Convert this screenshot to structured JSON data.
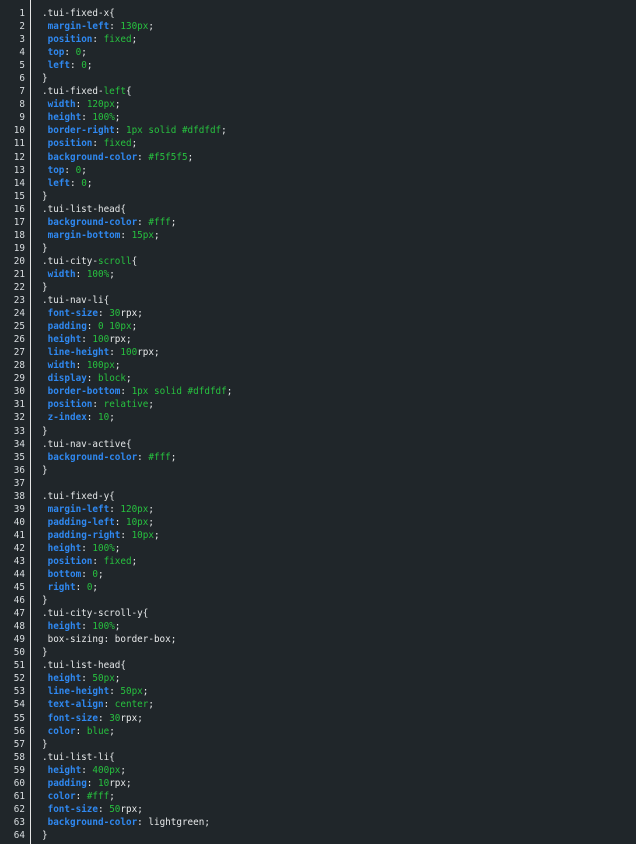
{
  "editor": {
    "lines": [
      [
        {
          "t": "sel",
          "v": ".tui-fixed-x{"
        }
      ],
      [
        {
          "t": "ind",
          "v": " "
        },
        {
          "t": "prop",
          "v": "margin-left"
        },
        {
          "t": "punc",
          "v": ": "
        },
        {
          "t": "val",
          "v": "130px"
        },
        {
          "t": "punc",
          "v": ";"
        }
      ],
      [
        {
          "t": "ind",
          "v": " "
        },
        {
          "t": "prop",
          "v": "position"
        },
        {
          "t": "punc",
          "v": ": "
        },
        {
          "t": "val",
          "v": "fixed"
        },
        {
          "t": "punc",
          "v": ";"
        }
      ],
      [
        {
          "t": "ind",
          "v": " "
        },
        {
          "t": "prop",
          "v": "top"
        },
        {
          "t": "punc",
          "v": ": "
        },
        {
          "t": "val",
          "v": "0"
        },
        {
          "t": "punc",
          "v": ";"
        }
      ],
      [
        {
          "t": "ind",
          "v": " "
        },
        {
          "t": "prop",
          "v": "left"
        },
        {
          "t": "punc",
          "v": ": "
        },
        {
          "t": "val",
          "v": "0"
        },
        {
          "t": "punc",
          "v": ";"
        }
      ],
      [
        {
          "t": "sel",
          "v": "}"
        }
      ],
      [
        {
          "t": "sel",
          "v": ".tui-fixed-"
        },
        {
          "t": "val",
          "v": "left"
        },
        {
          "t": "sel",
          "v": "{"
        }
      ],
      [
        {
          "t": "ind",
          "v": " "
        },
        {
          "t": "prop",
          "v": "width"
        },
        {
          "t": "punc",
          "v": ": "
        },
        {
          "t": "val",
          "v": "120px"
        },
        {
          "t": "punc",
          "v": ";"
        }
      ],
      [
        {
          "t": "ind",
          "v": " "
        },
        {
          "t": "prop",
          "v": "height"
        },
        {
          "t": "punc",
          "v": ": "
        },
        {
          "t": "val",
          "v": "100%"
        },
        {
          "t": "punc",
          "v": ";"
        }
      ],
      [
        {
          "t": "ind",
          "v": " "
        },
        {
          "t": "prop",
          "v": "border-right"
        },
        {
          "t": "punc",
          "v": ": "
        },
        {
          "t": "val",
          "v": "1px solid #dfdfdf"
        },
        {
          "t": "punc",
          "v": ";"
        }
      ],
      [
        {
          "t": "ind",
          "v": " "
        },
        {
          "t": "prop",
          "v": "position"
        },
        {
          "t": "punc",
          "v": ": "
        },
        {
          "t": "val",
          "v": "fixed"
        },
        {
          "t": "punc",
          "v": ";"
        }
      ],
      [
        {
          "t": "ind",
          "v": " "
        },
        {
          "t": "prop",
          "v": "background-color"
        },
        {
          "t": "punc",
          "v": ": "
        },
        {
          "t": "val",
          "v": "#f5f5f5"
        },
        {
          "t": "punc",
          "v": ";"
        }
      ],
      [
        {
          "t": "ind",
          "v": " "
        },
        {
          "t": "prop",
          "v": "top"
        },
        {
          "t": "punc",
          "v": ": "
        },
        {
          "t": "val",
          "v": "0"
        },
        {
          "t": "punc",
          "v": ";"
        }
      ],
      [
        {
          "t": "ind",
          "v": " "
        },
        {
          "t": "prop",
          "v": "left"
        },
        {
          "t": "punc",
          "v": ": "
        },
        {
          "t": "val",
          "v": "0"
        },
        {
          "t": "punc",
          "v": ";"
        }
      ],
      [
        {
          "t": "sel",
          "v": "}"
        }
      ],
      [
        {
          "t": "sel",
          "v": ".tui-list-head{"
        }
      ],
      [
        {
          "t": "ind",
          "v": " "
        },
        {
          "t": "prop",
          "v": "background-color"
        },
        {
          "t": "punc",
          "v": ": "
        },
        {
          "t": "val",
          "v": "#fff"
        },
        {
          "t": "punc",
          "v": ";"
        }
      ],
      [
        {
          "t": "ind",
          "v": " "
        },
        {
          "t": "prop",
          "v": "margin-bottom"
        },
        {
          "t": "punc",
          "v": ": "
        },
        {
          "t": "val",
          "v": "15px"
        },
        {
          "t": "punc",
          "v": ";"
        }
      ],
      [
        {
          "t": "sel",
          "v": "}"
        }
      ],
      [
        {
          "t": "sel",
          "v": ".tui-city-"
        },
        {
          "t": "val",
          "v": "scroll"
        },
        {
          "t": "sel",
          "v": "{"
        }
      ],
      [
        {
          "t": "ind",
          "v": " "
        },
        {
          "t": "prop",
          "v": "width"
        },
        {
          "t": "punc",
          "v": ": "
        },
        {
          "t": "val",
          "v": "100%"
        },
        {
          "t": "punc",
          "v": ";"
        }
      ],
      [
        {
          "t": "sel",
          "v": "}"
        }
      ],
      [
        {
          "t": "sel",
          "v": ".tui-nav-li{"
        }
      ],
      [
        {
          "t": "ind",
          "v": " "
        },
        {
          "t": "prop",
          "v": "font-size"
        },
        {
          "t": "punc",
          "v": ": "
        },
        {
          "t": "val",
          "v": "30"
        },
        {
          "t": "plain",
          "v": "rpx"
        },
        {
          "t": "punc",
          "v": ";"
        }
      ],
      [
        {
          "t": "ind",
          "v": " "
        },
        {
          "t": "prop",
          "v": "padding"
        },
        {
          "t": "punc",
          "v": ": "
        },
        {
          "t": "val",
          "v": "0 10px"
        },
        {
          "t": "punc",
          "v": ";"
        }
      ],
      [
        {
          "t": "ind",
          "v": " "
        },
        {
          "t": "prop",
          "v": "height"
        },
        {
          "t": "punc",
          "v": ": "
        },
        {
          "t": "val",
          "v": "100"
        },
        {
          "t": "plain",
          "v": "rpx"
        },
        {
          "t": "punc",
          "v": ";"
        }
      ],
      [
        {
          "t": "ind",
          "v": " "
        },
        {
          "t": "prop",
          "v": "line-height"
        },
        {
          "t": "punc",
          "v": ": "
        },
        {
          "t": "val",
          "v": "100"
        },
        {
          "t": "plain",
          "v": "rpx"
        },
        {
          "t": "punc",
          "v": ";"
        }
      ],
      [
        {
          "t": "ind",
          "v": " "
        },
        {
          "t": "prop",
          "v": "width"
        },
        {
          "t": "punc",
          "v": ": "
        },
        {
          "t": "val",
          "v": "100px"
        },
        {
          "t": "punc",
          "v": ";"
        }
      ],
      [
        {
          "t": "ind",
          "v": " "
        },
        {
          "t": "prop",
          "v": "display"
        },
        {
          "t": "punc",
          "v": ": "
        },
        {
          "t": "val",
          "v": "block"
        },
        {
          "t": "punc",
          "v": ";"
        }
      ],
      [
        {
          "t": "ind",
          "v": " "
        },
        {
          "t": "prop",
          "v": "border-bottom"
        },
        {
          "t": "punc",
          "v": ": "
        },
        {
          "t": "val",
          "v": "1px solid #dfdfdf"
        },
        {
          "t": "punc",
          "v": ";"
        }
      ],
      [
        {
          "t": "ind",
          "v": " "
        },
        {
          "t": "prop",
          "v": "position"
        },
        {
          "t": "punc",
          "v": ": "
        },
        {
          "t": "val",
          "v": "relative"
        },
        {
          "t": "punc",
          "v": ";"
        }
      ],
      [
        {
          "t": "ind",
          "v": " "
        },
        {
          "t": "prop",
          "v": "z-index"
        },
        {
          "t": "punc",
          "v": ": "
        },
        {
          "t": "val",
          "v": "10"
        },
        {
          "t": "punc",
          "v": ";"
        }
      ],
      [
        {
          "t": "sel",
          "v": "}"
        }
      ],
      [
        {
          "t": "sel",
          "v": ".tui-nav-active{"
        }
      ],
      [
        {
          "t": "ind",
          "v": " "
        },
        {
          "t": "prop",
          "v": "background-color"
        },
        {
          "t": "punc",
          "v": ": "
        },
        {
          "t": "val",
          "v": "#fff"
        },
        {
          "t": "punc",
          "v": ";"
        }
      ],
      [
        {
          "t": "sel",
          "v": "}"
        }
      ],
      [],
      [
        {
          "t": "sel",
          "v": ".tui-fixed-y{"
        }
      ],
      [
        {
          "t": "ind",
          "v": " "
        },
        {
          "t": "prop",
          "v": "margin-left"
        },
        {
          "t": "punc",
          "v": ": "
        },
        {
          "t": "val",
          "v": "120px"
        },
        {
          "t": "punc",
          "v": ";"
        }
      ],
      [
        {
          "t": "ind",
          "v": " "
        },
        {
          "t": "prop",
          "v": "padding-left"
        },
        {
          "t": "punc",
          "v": ": "
        },
        {
          "t": "val",
          "v": "10px"
        },
        {
          "t": "punc",
          "v": ";"
        }
      ],
      [
        {
          "t": "ind",
          "v": " "
        },
        {
          "t": "prop",
          "v": "padding-right"
        },
        {
          "t": "punc",
          "v": ": "
        },
        {
          "t": "val",
          "v": "10px"
        },
        {
          "t": "punc",
          "v": ";"
        }
      ],
      [
        {
          "t": "ind",
          "v": " "
        },
        {
          "t": "prop",
          "v": "height"
        },
        {
          "t": "punc",
          "v": ": "
        },
        {
          "t": "val",
          "v": "100%"
        },
        {
          "t": "punc",
          "v": ";"
        }
      ],
      [
        {
          "t": "ind",
          "v": " "
        },
        {
          "t": "prop",
          "v": "position"
        },
        {
          "t": "punc",
          "v": ": "
        },
        {
          "t": "val",
          "v": "fixed"
        },
        {
          "t": "punc",
          "v": ";"
        }
      ],
      [
        {
          "t": "ind",
          "v": " "
        },
        {
          "t": "prop",
          "v": "bottom"
        },
        {
          "t": "punc",
          "v": ": "
        },
        {
          "t": "val",
          "v": "0"
        },
        {
          "t": "punc",
          "v": ";"
        }
      ],
      [
        {
          "t": "ind",
          "v": " "
        },
        {
          "t": "prop",
          "v": "right"
        },
        {
          "t": "punc",
          "v": ": "
        },
        {
          "t": "val",
          "v": "0"
        },
        {
          "t": "punc",
          "v": ";"
        }
      ],
      [
        {
          "t": "sel",
          "v": "}"
        }
      ],
      [
        {
          "t": "sel",
          "v": ".tui-city-scroll-y{"
        }
      ],
      [
        {
          "t": "ind",
          "v": " "
        },
        {
          "t": "prop",
          "v": "height"
        },
        {
          "t": "punc",
          "v": ": "
        },
        {
          "t": "val",
          "v": "100%"
        },
        {
          "t": "punc",
          "v": ";"
        }
      ],
      [
        {
          "t": "ind",
          "v": " "
        },
        {
          "t": "plain",
          "v": "box-sizing: border-box;"
        }
      ],
      [
        {
          "t": "sel",
          "v": "}"
        }
      ],
      [
        {
          "t": "sel",
          "v": ".tui-list-head{"
        }
      ],
      [
        {
          "t": "ind",
          "v": " "
        },
        {
          "t": "prop",
          "v": "height"
        },
        {
          "t": "punc",
          "v": ": "
        },
        {
          "t": "val",
          "v": "50px"
        },
        {
          "t": "punc",
          "v": ";"
        }
      ],
      [
        {
          "t": "ind",
          "v": " "
        },
        {
          "t": "prop",
          "v": "line-height"
        },
        {
          "t": "punc",
          "v": ": "
        },
        {
          "t": "val",
          "v": "50px"
        },
        {
          "t": "punc",
          "v": ";"
        }
      ],
      [
        {
          "t": "ind",
          "v": " "
        },
        {
          "t": "prop",
          "v": "text-align"
        },
        {
          "t": "punc",
          "v": ": "
        },
        {
          "t": "val",
          "v": "center"
        },
        {
          "t": "punc",
          "v": ";"
        }
      ],
      [
        {
          "t": "ind",
          "v": " "
        },
        {
          "t": "prop",
          "v": "font-size"
        },
        {
          "t": "punc",
          "v": ": "
        },
        {
          "t": "val",
          "v": "30"
        },
        {
          "t": "plain",
          "v": "rpx"
        },
        {
          "t": "punc",
          "v": ";"
        }
      ],
      [
        {
          "t": "ind",
          "v": " "
        },
        {
          "t": "prop",
          "v": "color"
        },
        {
          "t": "punc",
          "v": ": "
        },
        {
          "t": "val",
          "v": "blue"
        },
        {
          "t": "punc",
          "v": ";"
        }
      ],
      [
        {
          "t": "sel",
          "v": "}"
        }
      ],
      [
        {
          "t": "sel",
          "v": ".tui-list-li{"
        }
      ],
      [
        {
          "t": "ind",
          "v": " "
        },
        {
          "t": "prop",
          "v": "height"
        },
        {
          "t": "punc",
          "v": ": "
        },
        {
          "t": "val",
          "v": "400px"
        },
        {
          "t": "punc",
          "v": ";"
        }
      ],
      [
        {
          "t": "ind",
          "v": " "
        },
        {
          "t": "prop",
          "v": "padding"
        },
        {
          "t": "punc",
          "v": ": "
        },
        {
          "t": "val",
          "v": "10"
        },
        {
          "t": "plain",
          "v": "rpx"
        },
        {
          "t": "punc",
          "v": ";"
        }
      ],
      [
        {
          "t": "ind",
          "v": " "
        },
        {
          "t": "prop",
          "v": "color"
        },
        {
          "t": "punc",
          "v": ": "
        },
        {
          "t": "val",
          "v": "#fff"
        },
        {
          "t": "punc",
          "v": ";"
        }
      ],
      [
        {
          "t": "ind",
          "v": " "
        },
        {
          "t": "prop",
          "v": "font-size"
        },
        {
          "t": "punc",
          "v": ": "
        },
        {
          "t": "val",
          "v": "50"
        },
        {
          "t": "plain",
          "v": "rpx"
        },
        {
          "t": "punc",
          "v": ";"
        }
      ],
      [
        {
          "t": "ind",
          "v": " "
        },
        {
          "t": "prop",
          "v": "background-color"
        },
        {
          "t": "punc",
          "v": ": "
        },
        {
          "t": "plain",
          "v": "lightgreen"
        },
        {
          "t": "punc",
          "v": ";"
        }
      ],
      [
        {
          "t": "sel",
          "v": "}"
        }
      ]
    ]
  },
  "colors": {
    "background": "#20262a",
    "property": "#2f88f0",
    "value": "#27c13f",
    "text": "#e8eaeb",
    "gutter_border": "#e6e6e6"
  }
}
